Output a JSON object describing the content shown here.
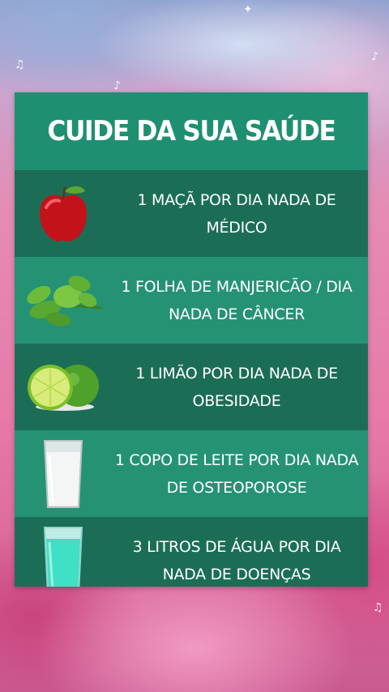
{
  "header": {
    "title": "CUIDE DA SUA SAÚDE"
  },
  "items": [
    {
      "icon": "apple-icon",
      "line1": "1 MAÇÃ POR DIA NADA DE",
      "line2": "MÉDICO"
    },
    {
      "icon": "basil-leaf-icon",
      "line1": "1 FOLHA DE MANJERICÃO / DIA",
      "line2": "NADA DE CÂNCER"
    },
    {
      "icon": "lime-icon",
      "line1": "1 LIMÃO POR DIA NADA DE",
      "line2": "OBESIDADE"
    },
    {
      "icon": "milk-glass-icon",
      "line1": "1 COPO DE LEITE POR DIA NADA",
      "line2": "DE OSTEOPOROSE"
    },
    {
      "icon": "water-glass-icon",
      "line1": "3 LITROS DE ÁGUA POR DIA",
      "line2": "NADA DE DOENÇAS"
    }
  ],
  "colors": {
    "card": "#1f8a6d",
    "row_dark": "#1b6e55",
    "row_light": "#259274",
    "text": "#ffffff"
  }
}
